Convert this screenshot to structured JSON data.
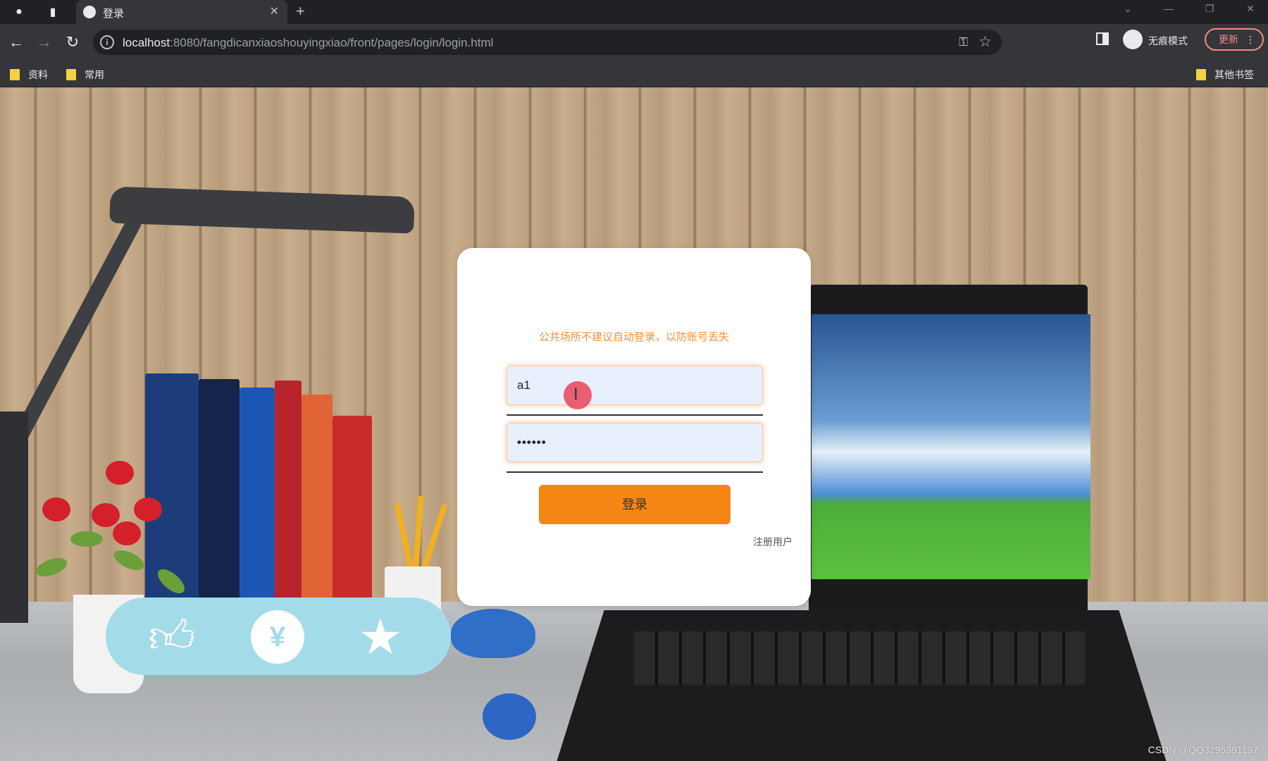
{
  "browser": {
    "tab_title": "登录",
    "url_host": "localhost",
    "url_rest": ":8080/fangdicanxiaoshouyingxiao/front/pages/login/login.html",
    "profile_label": "无痕模式",
    "update_label": "更新",
    "bookmarks": [
      "资料",
      "常用"
    ],
    "other_bookmarks": "其他书签"
  },
  "login": {
    "hint": "公共场所不建议自动登录，以防账号丢失",
    "username_value": "a1",
    "password_value": "••••••",
    "submit_label": "登录",
    "register_label": "注册用户"
  },
  "watermark": "CSDN @QQ3295391197",
  "colors": {
    "accent": "#f58614",
    "hint": "#f0913c",
    "social_bar": "#a4dbe9"
  },
  "icons": {
    "social": [
      "thumbs-up-icon",
      "coin-icon",
      "star-icon"
    ]
  }
}
